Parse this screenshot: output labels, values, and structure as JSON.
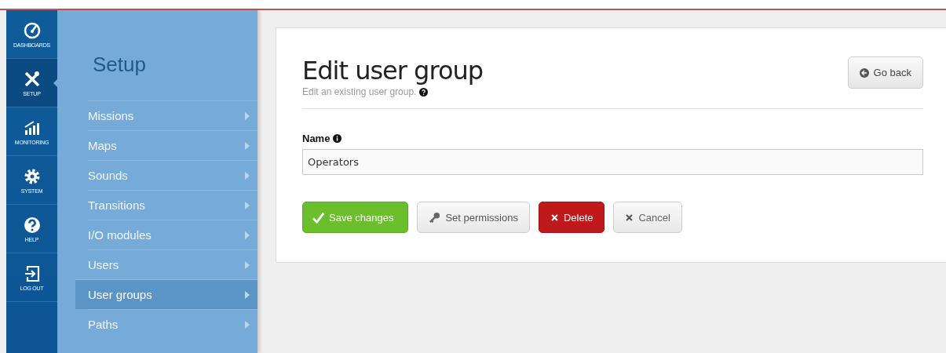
{
  "nav": [
    {
      "label": "DASHBOARDS",
      "kind": "gauge",
      "selected": false
    },
    {
      "label": "SETUP",
      "kind": "tools",
      "selected": true
    },
    {
      "label": "MONITORING",
      "kind": "chart",
      "selected": false
    },
    {
      "label": "SYSTEM",
      "kind": "gear",
      "selected": false
    },
    {
      "label": "HELP",
      "kind": "help",
      "selected": false
    },
    {
      "label": "LOG OUT",
      "kind": "logout",
      "selected": false
    }
  ],
  "submenu": {
    "title": "Setup",
    "items": [
      {
        "label": "Missions",
        "selected": false
      },
      {
        "label": "Maps",
        "selected": false
      },
      {
        "label": "Sounds",
        "selected": false
      },
      {
        "label": "Transitions",
        "selected": false
      },
      {
        "label": "I/O modules",
        "selected": false
      },
      {
        "label": "Users",
        "selected": false
      },
      {
        "label": "User groups",
        "selected": true
      },
      {
        "label": "Paths",
        "selected": false
      }
    ]
  },
  "page": {
    "title": "Edit user group",
    "subtitle": "Edit an existing user group.",
    "back_button": "Go back",
    "field": {
      "label": "Name",
      "value": "Operators"
    },
    "buttons": [
      {
        "label": "Save changes",
        "kind": "save"
      },
      {
        "label": "Set permissions",
        "kind": "permissions"
      },
      {
        "label": "Delete",
        "kind": "delete"
      },
      {
        "label": "Cancel",
        "kind": "cancel"
      }
    ]
  }
}
